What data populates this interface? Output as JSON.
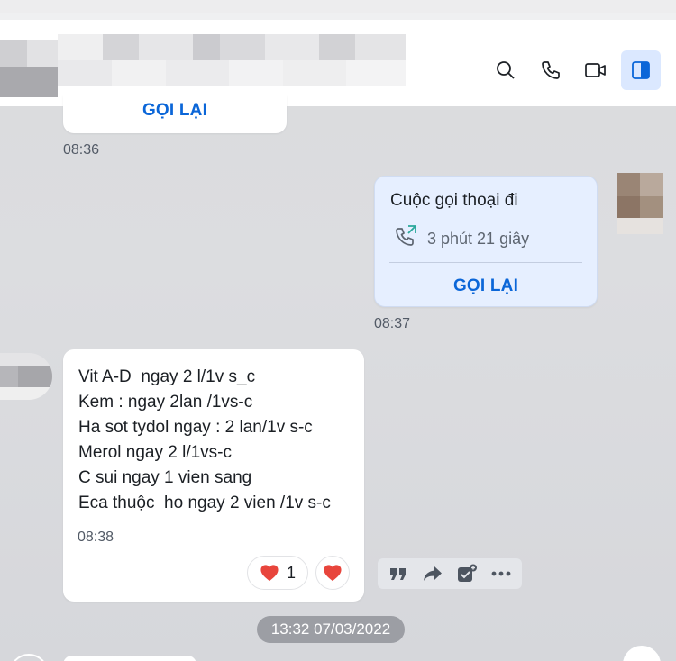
{
  "header": {
    "icons": [
      "search-icon",
      "phone-icon",
      "video-icon",
      "sidebar-toggle-icon"
    ]
  },
  "messages": {
    "prev_call": {
      "callback_label": "GỌI LẠI",
      "time": "08:36"
    },
    "outgoing_call": {
      "title": "Cuộc gọi thoại đi",
      "duration": "3 phút 21 giây",
      "callback_label": "GỌI LẠI",
      "time": "08:37"
    },
    "prescription": {
      "lines": [
        "Vit A-D  ngay 2 l/1v s_c",
        "Kem : ngay 2lan /1vs-c",
        "Ha sot tydol ngay : 2 lan/1v s-c",
        "Merol ngay 2 l/1vs-c",
        "C sui ngay 1 vien sang",
        "Eca thuộc  ho ngay 2 vien /1v s-c"
      ],
      "time": "08:38",
      "reaction_count": "1"
    }
  },
  "date_separator": "13:32 07/03/2022",
  "colors": {
    "accent": "#0b66d8",
    "heart": "#e8453c",
    "call_icon": "#2aa79b"
  }
}
